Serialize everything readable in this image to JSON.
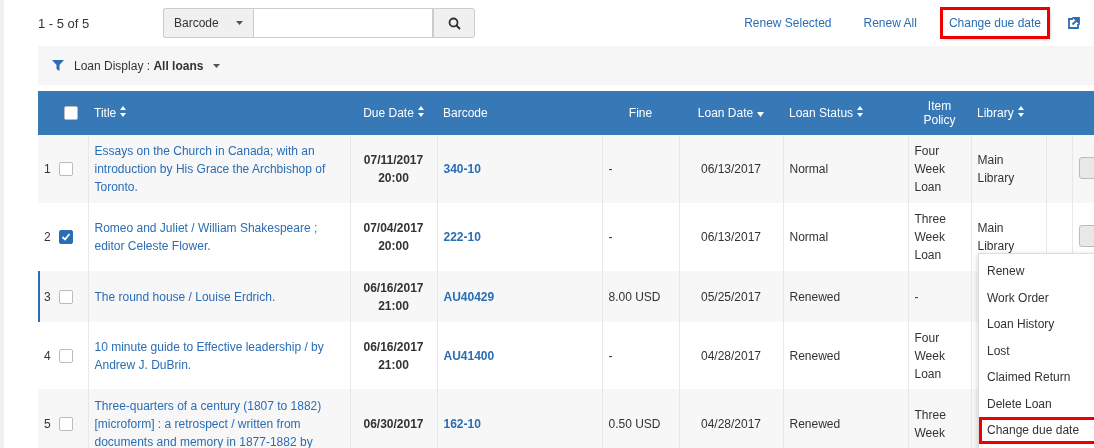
{
  "toolbar": {
    "count": "1 - 5 of 5",
    "search_scope": "Barcode",
    "actions": [
      {
        "label": "Renew Selected",
        "highlighted": false
      },
      {
        "label": "Renew All",
        "highlighted": false
      },
      {
        "label": "Change due date",
        "highlighted": true
      }
    ]
  },
  "filter": {
    "label": "Loan Display :",
    "value": "All loans"
  },
  "table": {
    "columns": [
      {
        "label": "Title",
        "sortable": true,
        "sorted_desc": false
      },
      {
        "label": "Due Date",
        "sortable": true,
        "sorted_desc": false
      },
      {
        "label": "Barcode",
        "sortable": false
      },
      {
        "label": "Fine",
        "sortable": false
      },
      {
        "label": "Loan Date",
        "sortable": true,
        "sorted_desc": true
      },
      {
        "label": "Loan Status",
        "sortable": true,
        "sorted_desc": false
      },
      {
        "label": "Item Policy",
        "sortable": false
      },
      {
        "label": "Library",
        "sortable": true,
        "sorted_desc": false
      }
    ],
    "header_checked": false,
    "rows": [
      {
        "index": "1",
        "checked": false,
        "focused": false,
        "title": "Essays on the Church in Canada; with an introduction by His Grace the Archbishop of Toronto.",
        "due_date": "07/11/2017",
        "due_time": "20:00",
        "barcode": "340-10",
        "fine": "-",
        "loan_date": "06/13/2017",
        "loan_status": "Normal",
        "item_policy": "Four Week Loan",
        "library": "Main Library",
        "has_action": true
      },
      {
        "index": "2",
        "checked": true,
        "focused": false,
        "title": "Romeo and Juliet / William Shakespeare ; editor Celeste Flower.",
        "due_date": "07/04/2017",
        "due_time": "20:00",
        "barcode": "222-10",
        "fine": "-",
        "loan_date": "06/13/2017",
        "loan_status": "Normal",
        "item_policy": "Three Week Loan",
        "library": "Main Library",
        "has_action": true
      },
      {
        "index": "3",
        "checked": false,
        "focused": true,
        "title": "The round house / Louise Erdrich.",
        "due_date": "06/16/2017",
        "due_time": "21:00",
        "barcode": "AU40429",
        "fine": "8.00 USD",
        "loan_date": "05/25/2017",
        "loan_status": "Renewed",
        "item_policy": "-"
      },
      {
        "index": "4",
        "checked": false,
        "focused": false,
        "title": "10 minute guide to Effective leadership / by Andrew J. DuBrin.",
        "due_date": "06/16/2017",
        "due_time": "21:00",
        "barcode": "AU41400",
        "fine": "-",
        "loan_date": "04/28/2017",
        "loan_status": "Renewed",
        "item_policy": "Four Week Loan"
      },
      {
        "index": "5",
        "checked": false,
        "focused": false,
        "title": "Three-quarters of a century (1807 to 1882) [microform] : a retrospect / written from documents and memory in 1877-1882 by",
        "due_date": "06/30/2017",
        "barcode": "162-10",
        "fine": "0.50 USD",
        "loan_date": "04/28/2017",
        "loan_status": "Renewed",
        "item_policy": "Three Week"
      }
    ]
  },
  "menu": {
    "items": [
      {
        "label": "Renew",
        "highlighted": false
      },
      {
        "label": "Work Order",
        "highlighted": false
      },
      {
        "label": "Loan History",
        "highlighted": false
      },
      {
        "label": "Lost",
        "highlighted": false
      },
      {
        "label": "Claimed Return",
        "highlighted": false
      },
      {
        "label": "Delete Loan",
        "highlighted": false
      },
      {
        "label": "Change due date",
        "highlighted": true
      }
    ]
  }
}
